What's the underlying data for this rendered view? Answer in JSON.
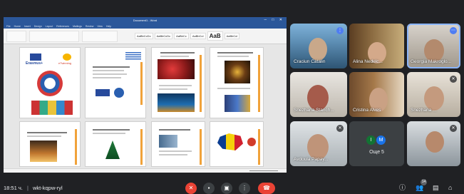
{
  "shared_screen": {
    "window_title": "Document1 - Word",
    "tabs": [
      "File",
      "Home",
      "Insert",
      "Design",
      "Layout",
      "References",
      "Mailings",
      "Review",
      "View",
      "Help"
    ],
    "styles": [
      "AaBbCcDc",
      "AaBbCcDc",
      "AaBbCc",
      "AaBbCcI",
      "AaB",
      "AaBbCcI"
    ],
    "page1_logos": [
      "Erasmus+",
      "eTwinning"
    ]
  },
  "participants": [
    {
      "name": "Craciun Catalin",
      "mic": "muted"
    },
    {
      "name": "Alina Nedelc...",
      "mic": "muted"
    },
    {
      "name": "Georgia Makroglo...",
      "mic": "speaking"
    },
    {
      "name": "Snezhana Stanch...",
      "mic": "muted"
    },
    {
      "name": "Cristina Alves",
      "mic": "muted"
    },
    {
      "name": "Snezhana ...",
      "mic": "muted"
    },
    {
      "name": "Avdoula Papay...",
      "mic": "muted"
    },
    {
      "name": "Още 5",
      "avatars": [
        "I",
        "M"
      ],
      "avatar_colors": [
        "#137333",
        "#1a73e8"
      ]
    },
    {
      "name": "",
      "mic": "muted"
    }
  ],
  "bottom_bar": {
    "time": "18:51 ч.",
    "separator": "|",
    "meeting_code": "wkt-kqpw-ryl",
    "people_count": "14"
  },
  "colors": {
    "background": "#202124",
    "end_call": "#ea4335",
    "word_blue": "#2b579a",
    "accent": "#8ab4f8"
  }
}
